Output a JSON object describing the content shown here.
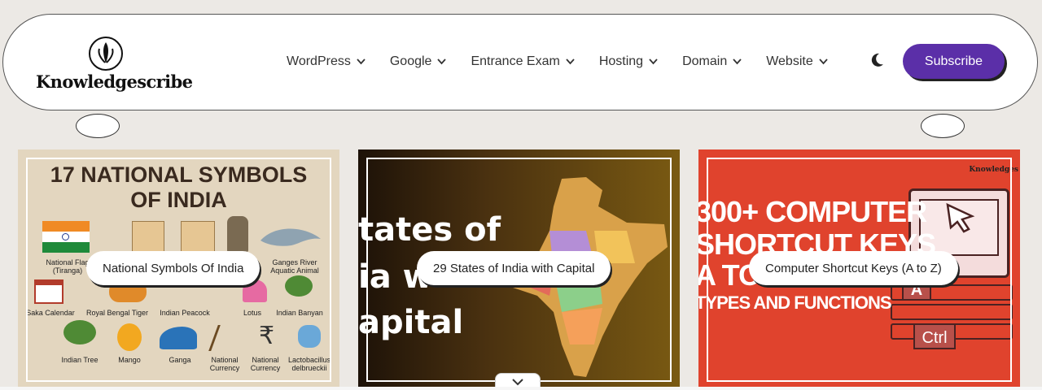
{
  "brand": {
    "name": "Knowledgescribe"
  },
  "nav": {
    "items": [
      {
        "label": "WordPress"
      },
      {
        "label": "Google"
      },
      {
        "label": "Entrance Exam"
      },
      {
        "label": "Hosting"
      },
      {
        "label": "Domain"
      },
      {
        "label": "Website"
      }
    ],
    "subscribe_label": "Subscribe",
    "theme_icon": "moon-icon"
  },
  "colors": {
    "accent": "#5b2fa8",
    "card3_bg": "#e0432d"
  },
  "cards": [
    {
      "label": "National Symbols Of India",
      "image_title_line1": "17 NATIONAL SYMBOLS",
      "image_title_line2": "OF INDIA",
      "symbols": [
        "National Flag",
        "(Tiranga)",
        "Ganges River",
        "Aquatic Animal",
        "Saka Calendar",
        "Royal Bengal Tiger",
        "Indian Peacock",
        "Lotus",
        "Indian Banyan",
        "Indian Tree",
        "Mango",
        "Ganga",
        "National Currency",
        "National Currency",
        "Lactobacillus delbrueckii"
      ]
    },
    {
      "label": "29 States of India with Capital",
      "image_line1": "tates of",
      "image_line2": "ia with",
      "image_line3": "apital"
    },
    {
      "label": "Computer Shortcut Keys (A to Z)",
      "image_line1": "300+ COMPUTER",
      "image_line2": "SHORTCUT KEYS",
      "image_line3": "A TO Z",
      "image_line4": "TYPES AND FUNCTIONS",
      "key_a": "A",
      "key_ctrl": "Ctrl",
      "corner_brand": "Knowledges"
    }
  ]
}
